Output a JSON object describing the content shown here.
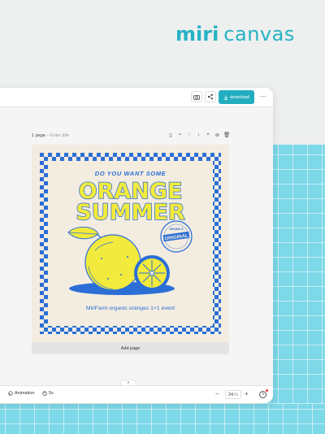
{
  "logo": {
    "brand": "miri",
    "name": "canvas"
  },
  "colors": {
    "accent": "#23aec0",
    "canvas_bg": "#f3ece0",
    "poster_blue": "#2b6fd6",
    "poster_yellow": "#f2ea3d",
    "teal_panel": "#7dd8e8"
  },
  "toolbar": {
    "camera_icon": "camera-icon",
    "share_icon": "share-icon",
    "download_label": "download",
    "more_icon": "more-icon"
  },
  "page": {
    "count_label": "1 page",
    "separator": "–",
    "title_placeholder": "Enter title",
    "tools": [
      "copy-icon",
      "paint-icon",
      "move-up-icon",
      "move-down-icon",
      "add-icon",
      "duplicate-icon",
      "trash-icon"
    ]
  },
  "poster": {
    "tagline": "DO YOU WANT SOME",
    "headline_1": "ORANGE",
    "headline_2": "SUMMER",
    "stamp_top": "GRADE A",
    "stamp_main": "ORIGINAL",
    "footer": "MiriFarm organic oranges 1+1 event"
  },
  "add_page_label": "Add page",
  "bottombar": {
    "animation_label": "Animation",
    "duration_label": "5s",
    "zoom_value": "24",
    "zoom_unit": "%",
    "help_label": "?"
  }
}
